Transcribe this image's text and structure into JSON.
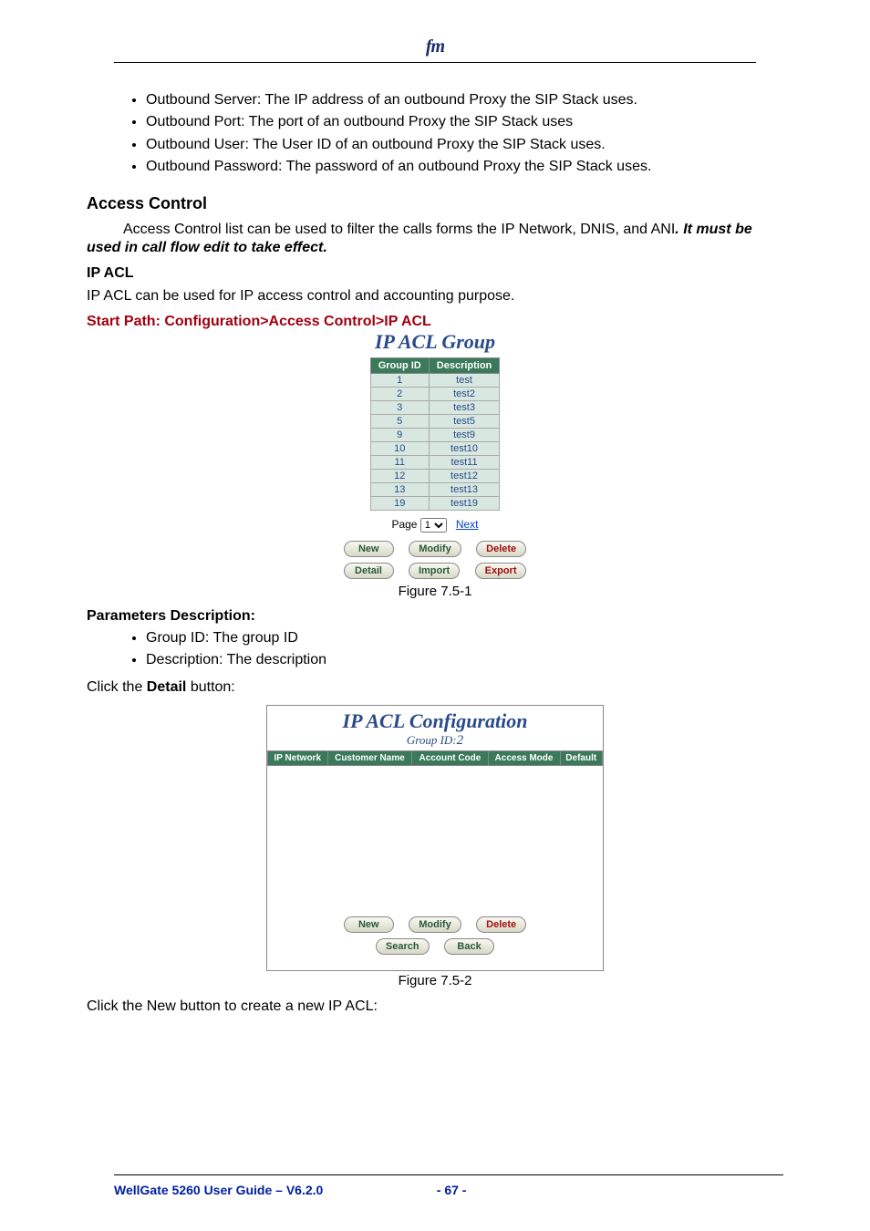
{
  "logo": "fm",
  "bullets_top": [
    "Outbound Server: The IP address of an outbound Proxy the SIP Stack uses.",
    "Outbound Port: The port of an outbound Proxy the SIP Stack uses",
    "Outbound User: The User ID of an outbound Proxy the SIP Stack uses.",
    "Outbound Password: The password of an outbound Proxy the SIP Stack uses."
  ],
  "section_title": "Access Control",
  "para1_a": "Access Control list can be used to filter the calls forms the IP Network, DNIS, and ANI",
  "para1_b": ". It must be used in call flow edit to take effect.",
  "ipacl_heading": "IP ACL",
  "ipacl_desc": " IP ACL can be used for IP access control and accounting purpose.",
  "start_path": "Start Path: Configuration>Access Control>IP ACL",
  "fig1": {
    "title": "IP ACL Group",
    "headers": {
      "c1": "Group ID",
      "c2": "Description"
    },
    "rows": [
      {
        "id": "1",
        "desc": "test"
      },
      {
        "id": "2",
        "desc": "test2"
      },
      {
        "id": "3",
        "desc": "test3"
      },
      {
        "id": "5",
        "desc": "test5"
      },
      {
        "id": "9",
        "desc": "test9"
      },
      {
        "id": "10",
        "desc": "test10"
      },
      {
        "id": "11",
        "desc": "test11"
      },
      {
        "id": "12",
        "desc": "test12"
      },
      {
        "id": "13",
        "desc": "test13"
      },
      {
        "id": "19",
        "desc": "test19"
      }
    ],
    "pager_label": "Page",
    "pager_value": "1",
    "pager_next": "Next",
    "buttons": {
      "new": "New",
      "modify": "Modify",
      "delete": "Delete",
      "detail": "Detail",
      "import": "Import",
      "export": "Export"
    },
    "caption": "Figure 7.5-1"
  },
  "params_heading": "Parameters Description:",
  "params_bullets": [
    "Group ID: The group ID",
    "Description: The description"
  ],
  "click_detail_a": "Click the ",
  "click_detail_b": "Detail",
  "click_detail_c": " button:",
  "fig2": {
    "title": "IP ACL Configuration",
    "subtitle_label": "Group ID:",
    "subtitle_value": "2",
    "headers": {
      "c1": "IP Network",
      "c2": "Customer Name",
      "c3": "Account Code",
      "c4": "Access Mode",
      "c5": "Default"
    },
    "buttons": {
      "new": "New",
      "modify": "Modify",
      "delete": "Delete",
      "search": "Search",
      "back": "Back"
    },
    "caption": "Figure 7.5-2"
  },
  "click_new": "Click the New button to create a new IP ACL:",
  "footer": {
    "title": "WellGate 5260 User Guide – V6.2.0",
    "page": "- 67 -"
  }
}
